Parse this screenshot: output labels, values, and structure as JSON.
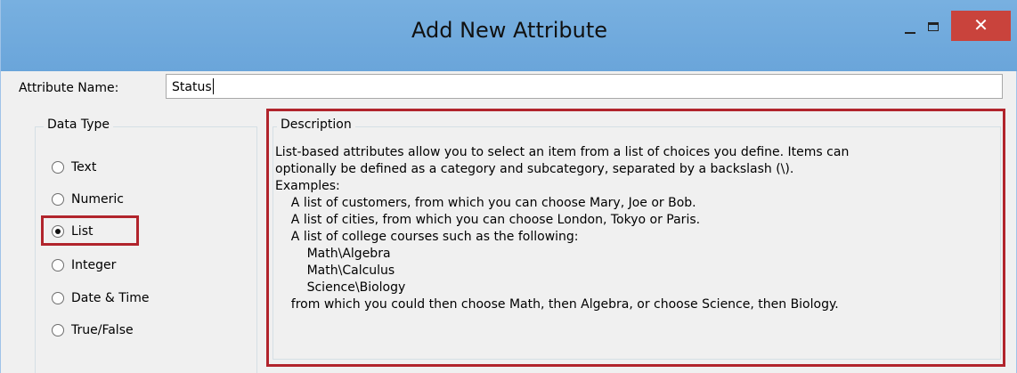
{
  "window": {
    "title": "Add New Attribute",
    "minimize_icon": "minimize-icon",
    "maximize_icon": "maximize-icon",
    "close_icon": "close-icon",
    "close_glyph": "✕"
  },
  "attribute": {
    "label": "Attribute Name:",
    "value": "Status"
  },
  "data_type": {
    "legend": "Data Type",
    "options": [
      {
        "label": "Text",
        "checked": false
      },
      {
        "label": "Numeric",
        "checked": false
      },
      {
        "label": "List",
        "checked": true
      },
      {
        "label": "Integer",
        "checked": false
      },
      {
        "label": "Date & Time",
        "checked": false
      },
      {
        "label": "True/False",
        "checked": false
      }
    ]
  },
  "description": {
    "legend": "Description",
    "lines": [
      "List-based attributes allow you to select an item from a list of choices you define. Items can",
      "optionally be defined as a category and subcategory, separated by a backslash (\\).",
      "Examples:",
      "    A list of customers, from which you can choose Mary, Joe or Bob.",
      "    A list of cities, from which you can choose London, Tokyo or Paris.",
      "    A list of college courses such as the following:",
      "        Math\\Algebra",
      "        Math\\Calculus",
      "        Science\\Biology",
      "    from which you could then choose Math, then Algebra, or choose Science, then Biology."
    ]
  },
  "colors": {
    "titlebar": "#6fa8dc",
    "close_button": "#c9433c",
    "highlight": "#b1242c"
  }
}
